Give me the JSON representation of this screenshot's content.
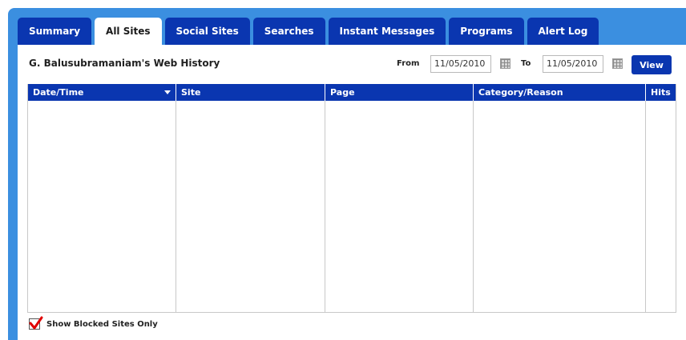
{
  "tabs": [
    {
      "label": "Summary",
      "active": false
    },
    {
      "label": "All Sites",
      "active": true
    },
    {
      "label": "Social Sites",
      "active": false
    },
    {
      "label": "Searches",
      "active": false
    },
    {
      "label": "Instant Messages",
      "active": false
    },
    {
      "label": "Programs",
      "active": false
    },
    {
      "label": "Alert Log",
      "active": false
    }
  ],
  "history": {
    "title": "G. Balusubramaniam's Web History",
    "from_label": "From",
    "from_value": "11/05/2010",
    "to_label": "To",
    "to_value": "11/05/2010",
    "view_label": "View"
  },
  "table": {
    "columns": [
      "Date/Time",
      "Site",
      "Page",
      "Category/Reason",
      "Hits"
    ],
    "rows": []
  },
  "filter": {
    "blocked_only_label": "Show Blocked Sites Only",
    "blocked_only_checked": true
  },
  "colors": {
    "frame": "#3b8fe0",
    "tab_bg": "#0a36b0",
    "check": "#e00000"
  }
}
